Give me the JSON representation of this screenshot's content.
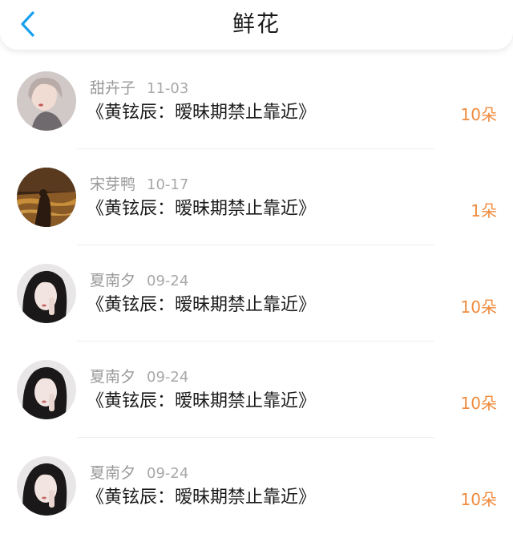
{
  "header": {
    "title": "鲜花",
    "back_icon": "chevron-left-icon"
  },
  "colors": {
    "accent_blue": "#1aa0f0",
    "amount_orange": "#f08a3c"
  },
  "gifts": [
    {
      "user": "甜卉子",
      "date": "11-03",
      "book": "《黄铉辰：暧昧期禁止靠近》",
      "amount": "10朵"
    },
    {
      "user": "宋芽鸭",
      "date": "10-17",
      "book": "《黄铉辰：暧昧期禁止靠近》",
      "amount": "1朵"
    },
    {
      "user": "夏南夕",
      "date": "09-24",
      "book": "《黄铉辰：暧昧期禁止靠近》",
      "amount": "10朵"
    },
    {
      "user": "夏南夕",
      "date": "09-24",
      "book": "《黄铉辰：暧昧期禁止靠近》",
      "amount": "10朵"
    },
    {
      "user": "夏南夕",
      "date": "09-24",
      "book": "《黄铉辰：暧昧期禁止靠近》",
      "amount": "10朵"
    }
  ]
}
